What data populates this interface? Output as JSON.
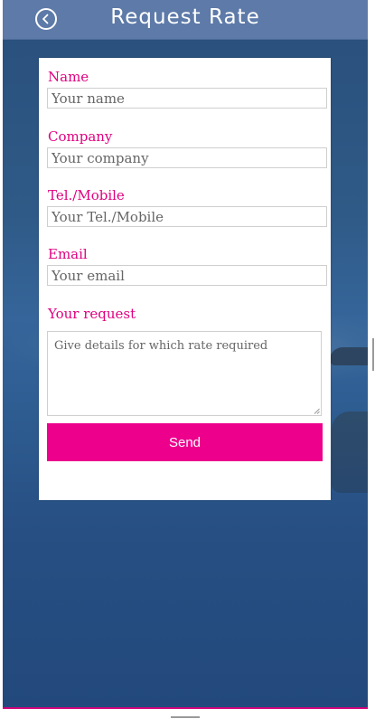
{
  "header": {
    "title": "Request Rate",
    "back_icon": "circle-left-arrow-icon"
  },
  "form": {
    "name": {
      "label": "Name",
      "placeholder": "Your name",
      "value": ""
    },
    "company": {
      "label": "Company",
      "placeholder": "Your company",
      "value": ""
    },
    "phone": {
      "label": "Tel./Mobile",
      "placeholder": "Your Tel./Mobile",
      "value": ""
    },
    "email": {
      "label": "Email",
      "placeholder": "Your email",
      "value": ""
    },
    "request": {
      "label": "Your request",
      "placeholder": "Give details for which rate required",
      "value": ""
    },
    "send_label": "Send"
  },
  "colors": {
    "header_bg": "#5d7aa8",
    "accent": "#ec008c",
    "label": "#e0007f",
    "background": "#2f5a87"
  }
}
